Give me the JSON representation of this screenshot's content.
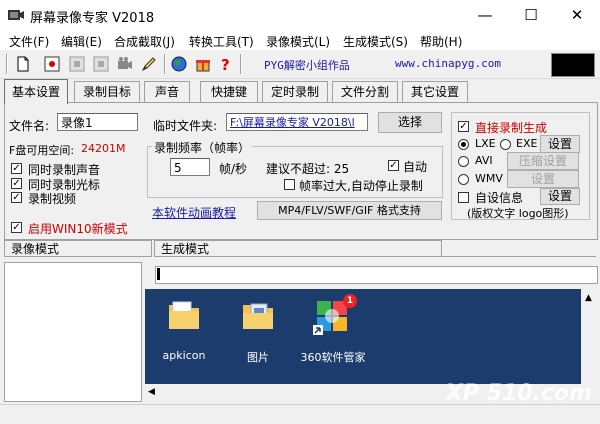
{
  "window": {
    "title": "屏幕录像专家 V2018",
    "minimize": "—",
    "maximize": "☐",
    "close": "✕"
  },
  "menu": [
    "文件(F)",
    "编辑(E)",
    "合成截取(J)",
    "转换工具(T)",
    "录像模式(L)",
    "生成模式(S)",
    "帮助(H)"
  ],
  "toolbar": {
    "pyg_text": "PYG解密小组作品",
    "url": "www.chinapyg.com"
  },
  "tabs": [
    "基本设置",
    "录制目标",
    "声音",
    "快捷键",
    "定时录制",
    "文件分割",
    "其它设置"
  ],
  "basic": {
    "filename_label": "文件名:",
    "filename_value": "录像1",
    "tempdir_label": "临时文件夹:",
    "tempdir_value": "F:\\屏幕录像专家 V2018\\l",
    "select_button": "选择",
    "disk_label": "F盘可用空间:",
    "disk_value": "24201M",
    "check_sound": "同时录制声音",
    "check_cursor": "同时录制光标",
    "check_video": "录制视频",
    "win10_mode": "启用WIN10新模式",
    "freq_group": "录制频率（帧率）",
    "fps_value": "5",
    "fps_unit": "帧/秒",
    "suggest_label": "建议不超过: 25",
    "auto_label": "自动",
    "auto_stop_label": "帧率过大,自动停止录制",
    "tutorial_link": "本软件动画教程",
    "format_button": "MP4/FLV/SWF/GIF 格式支持"
  },
  "output": {
    "direct_label": "直接录制生成",
    "lxe_label": "LXE",
    "exe_label": "EXE",
    "setting_button": "设置",
    "avi_label": "AVI",
    "compress_button": "压缩设置",
    "wmv_label": "WMV",
    "setting_button2": "设置",
    "custom_info_label": "自设信息",
    "setting_button3": "设置",
    "copyright_note": "(版权文字 logo图形)"
  },
  "bottom": {
    "record_mode_tab": "录像模式",
    "generate_mode_tab": "生成模式",
    "icons": [
      "apkicon",
      "图片",
      "360软件管家"
    ],
    "badge": "1",
    "watermark": "XP 510.com"
  },
  "colors": {
    "accent_red": "#d00000",
    "link_blue": "#1a1aa6",
    "desktop_bg": "#1c3c6e"
  }
}
